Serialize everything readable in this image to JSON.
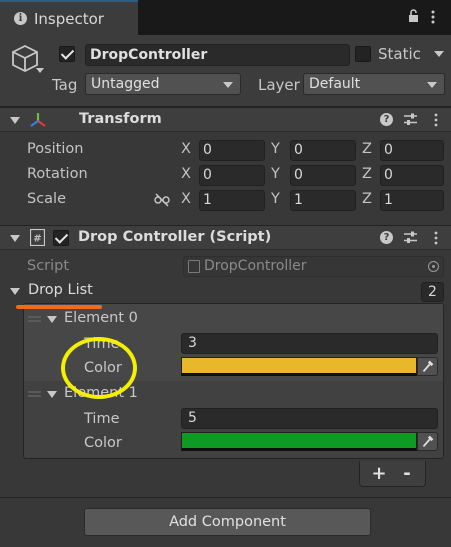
{
  "window": {
    "tab_label": "Inspector"
  },
  "header": {
    "object_name": "DropController",
    "active": true,
    "static_label": "Static",
    "tag_label": "Tag",
    "tag_value": "Untagged",
    "layer_label": "Layer",
    "layer_value": "Default"
  },
  "transform": {
    "title": "Transform",
    "rows": [
      {
        "label": "Position",
        "x": "0",
        "y": "0",
        "z": "0"
      },
      {
        "label": "Rotation",
        "x": "0",
        "y": "0",
        "z": "0"
      },
      {
        "label": "Scale",
        "x": "1",
        "y": "1",
        "z": "1"
      }
    ],
    "axis_labels": [
      "X",
      "Y",
      "Z"
    ]
  },
  "script_component": {
    "title": "Drop Controller (Script)",
    "enabled": true,
    "script_label": "Script",
    "script_value": "DropController",
    "list_label": "Drop List",
    "list_count": "2",
    "elements": [
      {
        "title": "Element 0",
        "time_label": "Time",
        "time_value": "3",
        "color_label": "Color",
        "color": "#e8b82b"
      },
      {
        "title": "Element 1",
        "time_label": "Time",
        "time_value": "5",
        "color_label": "Color",
        "color": "#0e9a23"
      }
    ],
    "add_label": "+",
    "remove_label": "-"
  },
  "add_component_label": "Add Component",
  "colors": {
    "accent_underline": "#f26b1d",
    "annotation": "#f4f000",
    "background": "#383838"
  }
}
